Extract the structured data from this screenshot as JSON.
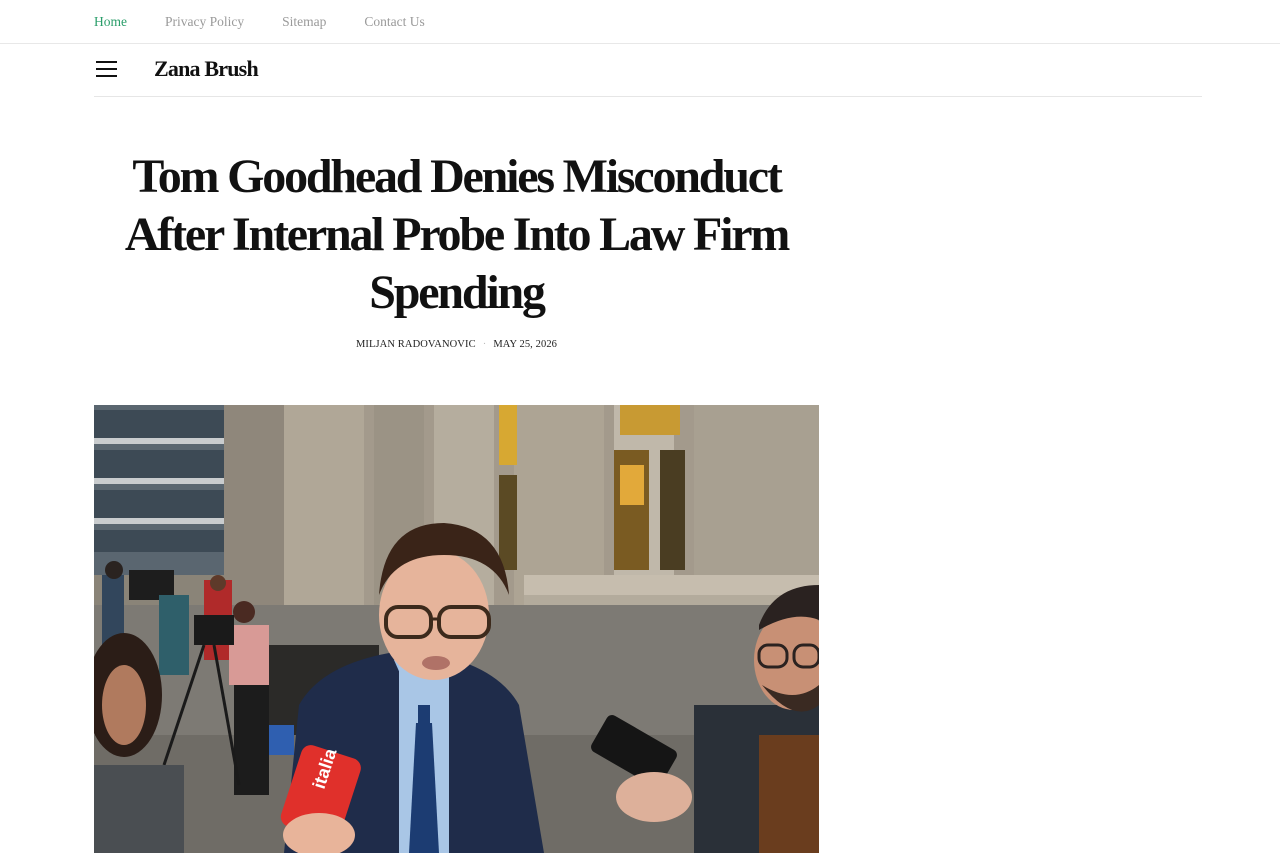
{
  "top_nav": {
    "items": [
      {
        "label": "Home",
        "active": true
      },
      {
        "label": "Privacy Policy",
        "active": false
      },
      {
        "label": "Sitemap",
        "active": false
      },
      {
        "label": "Contact Us",
        "active": false
      }
    ]
  },
  "header": {
    "menu_icon": "hamburger-menu-icon",
    "brand": "Zana Brush"
  },
  "article": {
    "headline": "Tom Goodhead Denies Misconduct After Internal Probe Into Law Firm Spending",
    "author": "MILJAN RADOVANOVIC",
    "separator": "·",
    "date": "MAY 25, 2026",
    "image_alt": "Man in glasses and blue suit speaking to reporters outside a stone building",
    "microphone_text": "italia"
  },
  "colors": {
    "accent": "#2a9d6a",
    "nav_text": "#9a9a9a",
    "text": "#111111"
  }
}
